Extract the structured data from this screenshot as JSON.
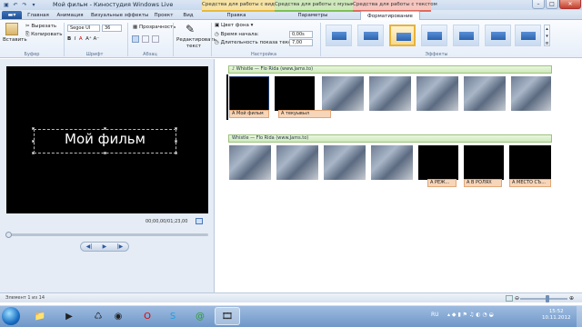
{
  "window": {
    "title": "Мой фильм - Киностудия Windows Live",
    "controls": {
      "minimize": "–",
      "maximize": "□",
      "close": "✕"
    }
  },
  "quick_access": [
    "save-icon",
    "undo-icon",
    "redo-icon",
    "dropdown-icon"
  ],
  "context_tabs": [
    {
      "label": "Средства для работы с видео",
      "color": "#f2d37a"
    },
    {
      "label": "Средства для работы с музыкой",
      "color": "#b7df9a"
    },
    {
      "label": "Средства для работы с текстом",
      "color": "#f2a9a0"
    }
  ],
  "tabs": {
    "file": "▬▾",
    "items": [
      "Главная",
      "Анимация",
      "Визуальные эффекты",
      "Проект",
      "Вид",
      "Правка",
      "Параметры",
      "Форматирование"
    ],
    "active": "Форматирование"
  },
  "ribbon": {
    "clipboard": {
      "paste": "Вставить",
      "cut": "Вырезать",
      "copy": "Копировать",
      "group": "Буфер"
    },
    "font": {
      "family": "Segoe UI",
      "size": "36",
      "group": "Шрифт"
    },
    "paragraph": {
      "transparency": "Прозрачность",
      "group": "Абзац"
    },
    "edit_text": {
      "label_line1": "Редактировать",
      "label_line2": "текст"
    },
    "settings": {
      "bg_color": "Цвет фона",
      "start_time_label": "Время начала:",
      "start_time_value": "0,00s",
      "duration_label": "Длительность показа текста:",
      "duration_value": "7,00",
      "group": "Настройка"
    },
    "effects": {
      "group": "Эффекты"
    }
  },
  "preview": {
    "caption": "Мой фильм",
    "timecode": "00;00,00/01;23,00",
    "controls": {
      "prev": "◀|",
      "play": "▶",
      "next": "|▶"
    }
  },
  "storyboard": {
    "track1": {
      "music": "♪ Whistle — Flo Rida (www.Jams.to)",
      "labels": [
        "A Мой фильм",
        "A текуывыл"
      ]
    },
    "track2": {
      "music": "Whistle — Flo Rida (www.Jams.to)",
      "labels": [
        "A РЕЖ...",
        "A В РОЛЯХ",
        "A МЕСТО СЪ..."
      ]
    }
  },
  "status": {
    "text": "Элемент 1 из 14"
  },
  "taskbar": {
    "clock_time": "15:52",
    "clock_date": "10.11.2012",
    "lang": "RU",
    "apps": [
      "folder-icon",
      "media-player-icon",
      "chrome-icon",
      "opera-icon",
      "skype-icon",
      "mail-icon",
      "moviemaker-icon"
    ]
  }
}
